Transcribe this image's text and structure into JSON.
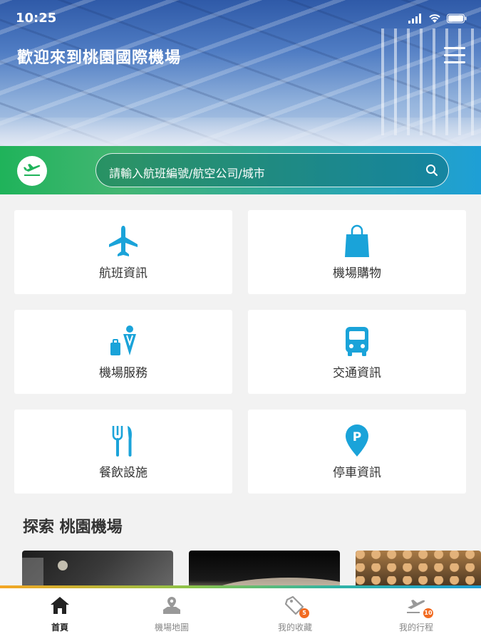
{
  "status_bar": {
    "time": "10:25"
  },
  "header": {
    "title": "歡迎來到桃園國際機場"
  },
  "search": {
    "placeholder": "請輸入航班編號/航空公司/城市"
  },
  "menu_cards": [
    {
      "label": "航班資訊",
      "icon": "airplane-icon"
    },
    {
      "label": "機場購物",
      "icon": "shopping-bag-icon"
    },
    {
      "label": "機場服務",
      "icon": "service-person-icon"
    },
    {
      "label": "交通資訊",
      "icon": "bus-icon"
    },
    {
      "label": "餐飲設施",
      "icon": "fork-knife-icon"
    },
    {
      "label": "停車資訊",
      "icon": "parking-pin-icon"
    }
  ],
  "explore": {
    "title": "探索 桃園機場"
  },
  "tabbar": {
    "items": [
      {
        "label": "首頁",
        "icon": "home-icon",
        "active": true
      },
      {
        "label": "機場地圖",
        "icon": "map-icon",
        "active": false
      },
      {
        "label": "我的收藏",
        "icon": "favorite-tag-icon",
        "active": false,
        "badge": "5"
      },
      {
        "label": "我的行程",
        "icon": "itinerary-plane-icon",
        "active": false,
        "badge": "10"
      }
    ]
  },
  "colors": {
    "accent_blue": "#1e9fd6",
    "accent_green": "#1fb35a",
    "badge_orange": "#f26b21"
  }
}
